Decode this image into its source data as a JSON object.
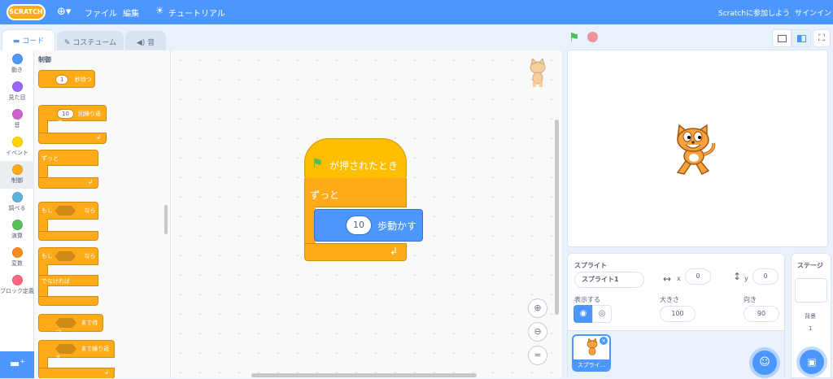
{
  "menubar": {
    "logo": "SCRATCH",
    "file": "ファイル",
    "edit": "編集",
    "tutorials": "チュートリアル",
    "join": "Scratchに参加しよう",
    "signin": "サインイン"
  },
  "tabs": {
    "code": "コード",
    "costumes": "コスチューム",
    "sounds": "音"
  },
  "categories": [
    {
      "label": "動き",
      "color": "#4c97ff"
    },
    {
      "label": "見た目",
      "color": "#9966ff"
    },
    {
      "label": "音",
      "color": "#cf63cf"
    },
    {
      "label": "イベント",
      "color": "#ffd500"
    },
    {
      "label": "制御",
      "color": "#ffab19"
    },
    {
      "label": "調べる",
      "color": "#5cb1d6"
    },
    {
      "label": "演算",
      "color": "#59c059"
    },
    {
      "label": "変数",
      "color": "#ff8c1a"
    },
    {
      "label": "ブロック定義",
      "color": "#ff6680"
    }
  ],
  "palette": {
    "heading": "制御",
    "wait_value": "1",
    "wait_label": "秒待つ",
    "repeat_value": "10",
    "repeat_label": "回繰り返す",
    "forever": "ずっと",
    "if": "もし",
    "then": "なら",
    "else": "でなければ",
    "wait_until": "まで待つ",
    "repeat_until": "まで繰り返す"
  },
  "script": {
    "hat": "が押されたとき",
    "forever": "ずっと",
    "move_value": "10",
    "move_label": "歩動かす"
  },
  "sprite": {
    "section_label": "スプライト",
    "name": "スプライト1",
    "x": "0",
    "y": "0",
    "show_label": "表示する",
    "size_label": "大きさ",
    "size": "100",
    "direction_label": "向き",
    "direction": "90",
    "thumb_label": "スプライ..."
  },
  "stage_panel": {
    "title": "ステージ",
    "backdrops_label": "背景",
    "backdrops_count": "1"
  }
}
